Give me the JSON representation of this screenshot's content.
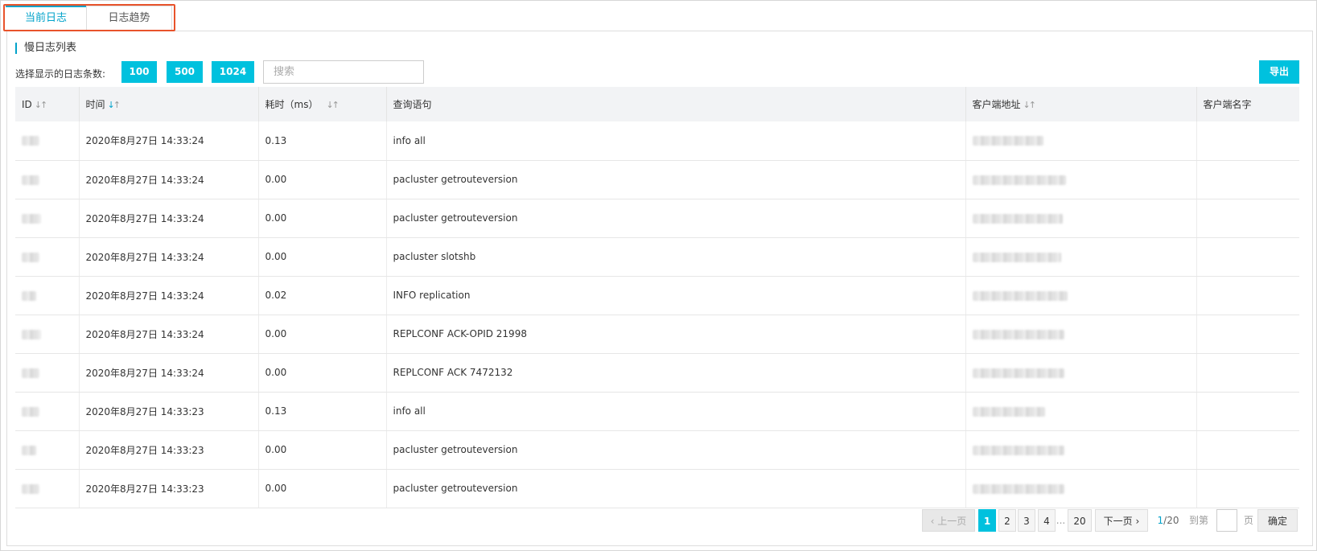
{
  "tabs": [
    {
      "label": "当前日志"
    },
    {
      "label": "日志趋势"
    }
  ],
  "section_title": "慢日志列表",
  "count_selector": {
    "label": "选择显示的日志条数:",
    "options": [
      "100",
      "500",
      "1024"
    ]
  },
  "search": {
    "placeholder": "搜索",
    "value": ""
  },
  "export_label": "导出",
  "table": {
    "columns": [
      "ID",
      "时间",
      "耗时（ms）",
      "查询语句",
      "客户端地址",
      "客户端名字"
    ],
    "rows": [
      {
        "time": "2020年8月27日 14:33:24",
        "duration": "0.13",
        "query": "info all"
      },
      {
        "time": "2020年8月27日 14:33:24",
        "duration": "0.00",
        "query": "pacluster getrouteversion"
      },
      {
        "time": "2020年8月27日 14:33:24",
        "duration": "0.00",
        "query": "pacluster getrouteversion"
      },
      {
        "time": "2020年8月27日 14:33:24",
        "duration": "0.00",
        "query": "pacluster slotshb"
      },
      {
        "time": "2020年8月27日 14:33:24",
        "duration": "0.02",
        "query": "INFO replication"
      },
      {
        "time": "2020年8月27日 14:33:24",
        "duration": "0.00",
        "query": "REPLCONF ACK-OPID 21998"
      },
      {
        "time": "2020年8月27日 14:33:24",
        "duration": "0.00",
        "query": "REPLCONF ACK 7472132"
      },
      {
        "time": "2020年8月27日 14:33:23",
        "duration": "0.13",
        "query": "info all"
      },
      {
        "time": "2020年8月27日 14:33:23",
        "duration": "0.00",
        "query": "pacluster getrouteversion"
      },
      {
        "time": "2020年8月27日 14:33:23",
        "duration": "0.00",
        "query": "pacluster getrouteversion"
      }
    ]
  },
  "pagination": {
    "prev_label": "上一页",
    "pages": [
      "1",
      "2",
      "3",
      "4"
    ],
    "ellipsis": "...",
    "last_page": "20",
    "next_label": "下一页",
    "current": "1",
    "total": "/20",
    "goto_label": "到第",
    "page_unit": "页",
    "confirm_label": "确定"
  },
  "colors": {
    "accent": "#00c1de",
    "tab_accent": "#00a2ca",
    "highlight_border": "#e8532b"
  },
  "icons": {
    "sort": "sort-icon",
    "prev": "chevron-left-icon",
    "next": "chevron-right-icon"
  }
}
